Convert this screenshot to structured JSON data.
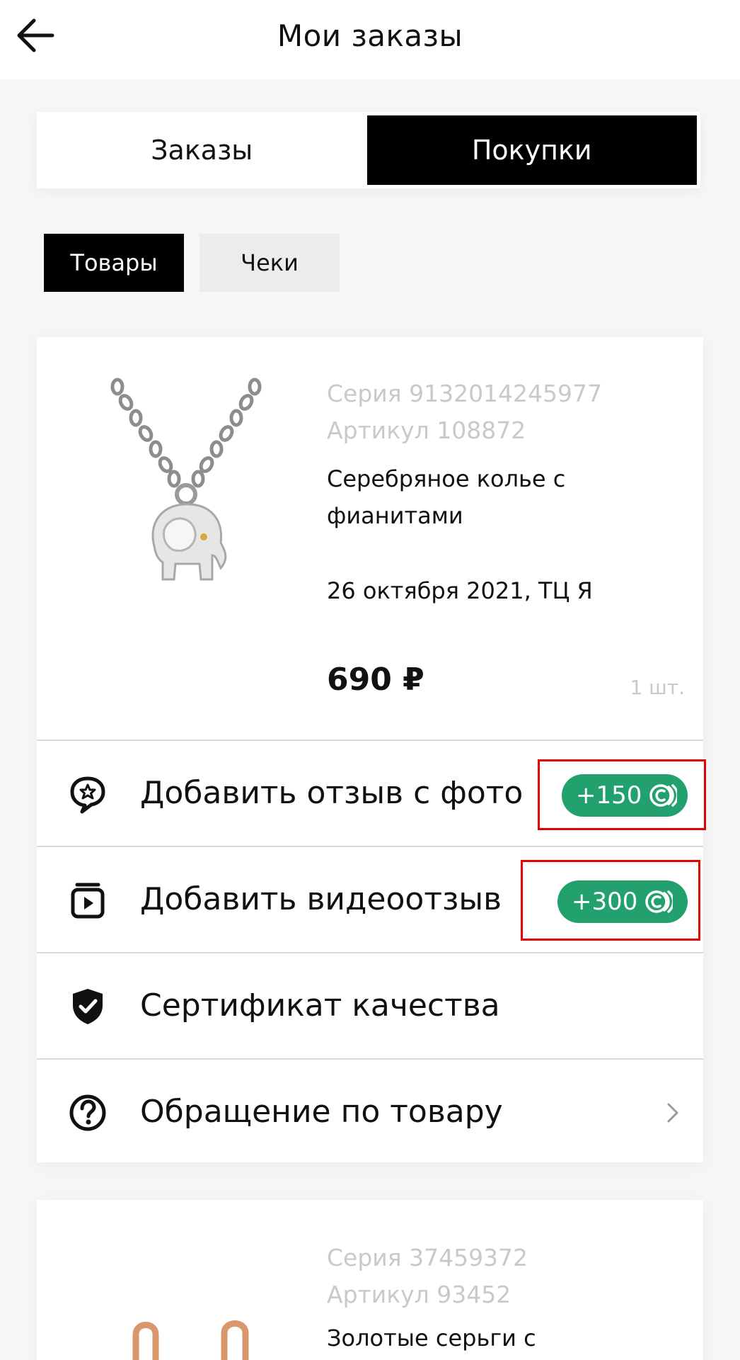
{
  "header": {
    "title": "Мои заказы",
    "back_icon": "arrow-left-icon"
  },
  "tabs": [
    {
      "label": "Заказы",
      "active": false
    },
    {
      "label": "Покупки",
      "active": true
    }
  ],
  "filters": [
    {
      "label": "Товары",
      "active": true
    },
    {
      "label": "Чеки",
      "active": false
    }
  ],
  "products": [
    {
      "series": "Серия 9132014245977",
      "article": "Артикул 108872",
      "name": "Серебряное колье с фианитами",
      "date_place": "26 октября 2021, ТЦ Я",
      "price": "690 ₽",
      "qty": "1 шт.",
      "image_icon": "elephant-necklace-image"
    },
    {
      "series": "Серия 37459372",
      "article": "Артикул 93452",
      "name": "Золотые серьги с",
      "image_icon": "gold-earrings-image"
    }
  ],
  "actions": [
    {
      "label": "Добавить отзыв с фото",
      "icon": "chat-star-icon",
      "badge": "+150"
    },
    {
      "label": "Добавить видеоотзыв",
      "icon": "video-play-icon",
      "badge": "+300"
    },
    {
      "label": "Сертификат качества",
      "icon": "shield-check-icon"
    },
    {
      "label": "Обращение по товару",
      "icon": "question-circle-icon",
      "chevron": "chevron-right-icon"
    }
  ],
  "colors": {
    "accent_green": "#22a06e",
    "highlight_red": "#e00000",
    "active_black": "#000000",
    "meta_grey": "#c9c9c9"
  }
}
